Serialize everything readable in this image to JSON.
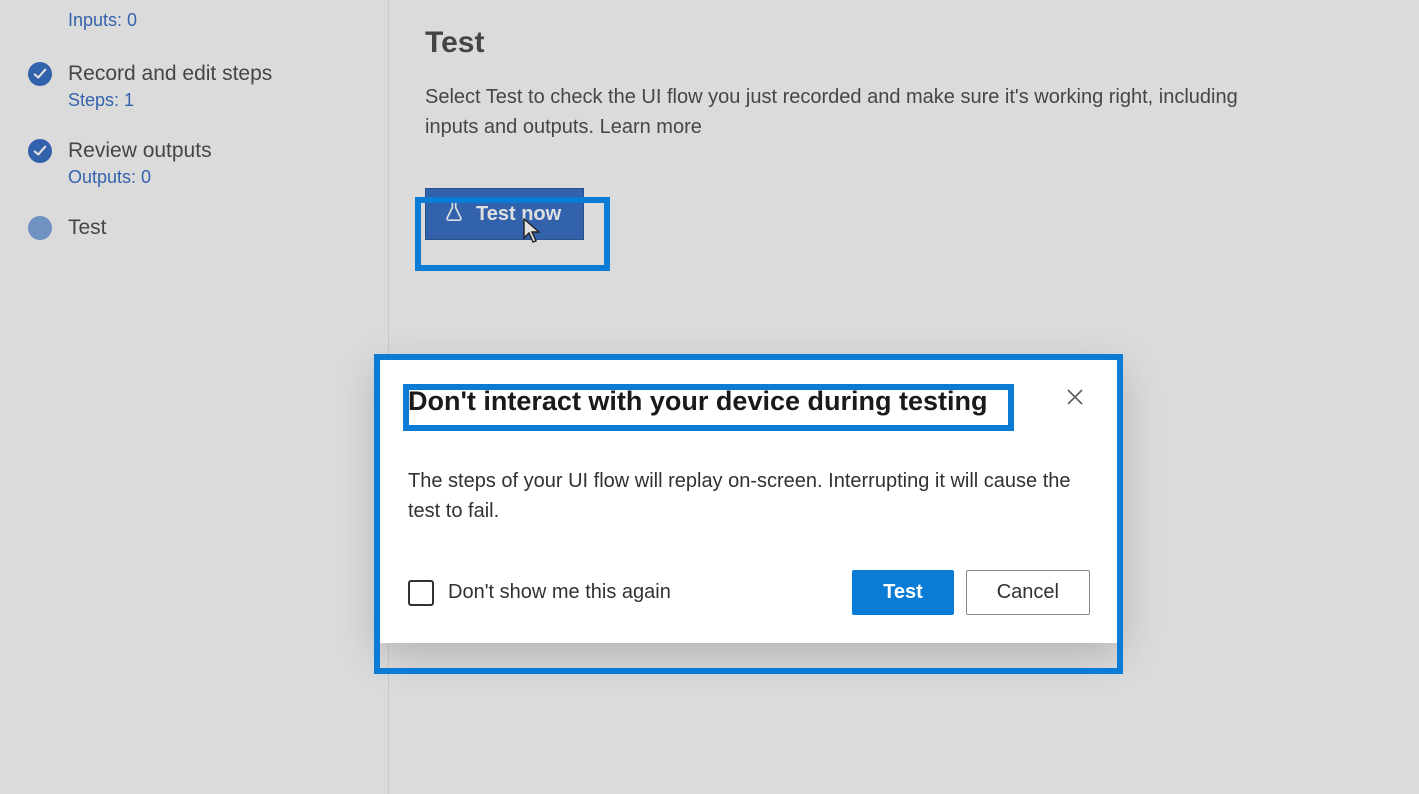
{
  "sidebar": {
    "steps": [
      {
        "title": "",
        "sub": "Inputs: 0",
        "state": "spacer"
      },
      {
        "title": "Record and edit steps",
        "sub": "Steps: 1",
        "state": "done"
      },
      {
        "title": "Review outputs",
        "sub": "Outputs: 0",
        "state": "done"
      },
      {
        "title": "Test",
        "sub": "",
        "state": "current"
      }
    ]
  },
  "main": {
    "title": "Test",
    "description": "Select Test to check the UI flow you just recorded and make sure it's working right, including inputs and outputs. ",
    "learn_more": "Learn more",
    "test_now_label": "Test now"
  },
  "modal": {
    "title": "Don't interact with your device during testing",
    "body": "The steps of your UI flow will replay on-screen. Interrupting it will cause the test to fail.",
    "checkbox_label": "Don't show me this again",
    "primary_label": "Test",
    "secondary_label": "Cancel"
  }
}
